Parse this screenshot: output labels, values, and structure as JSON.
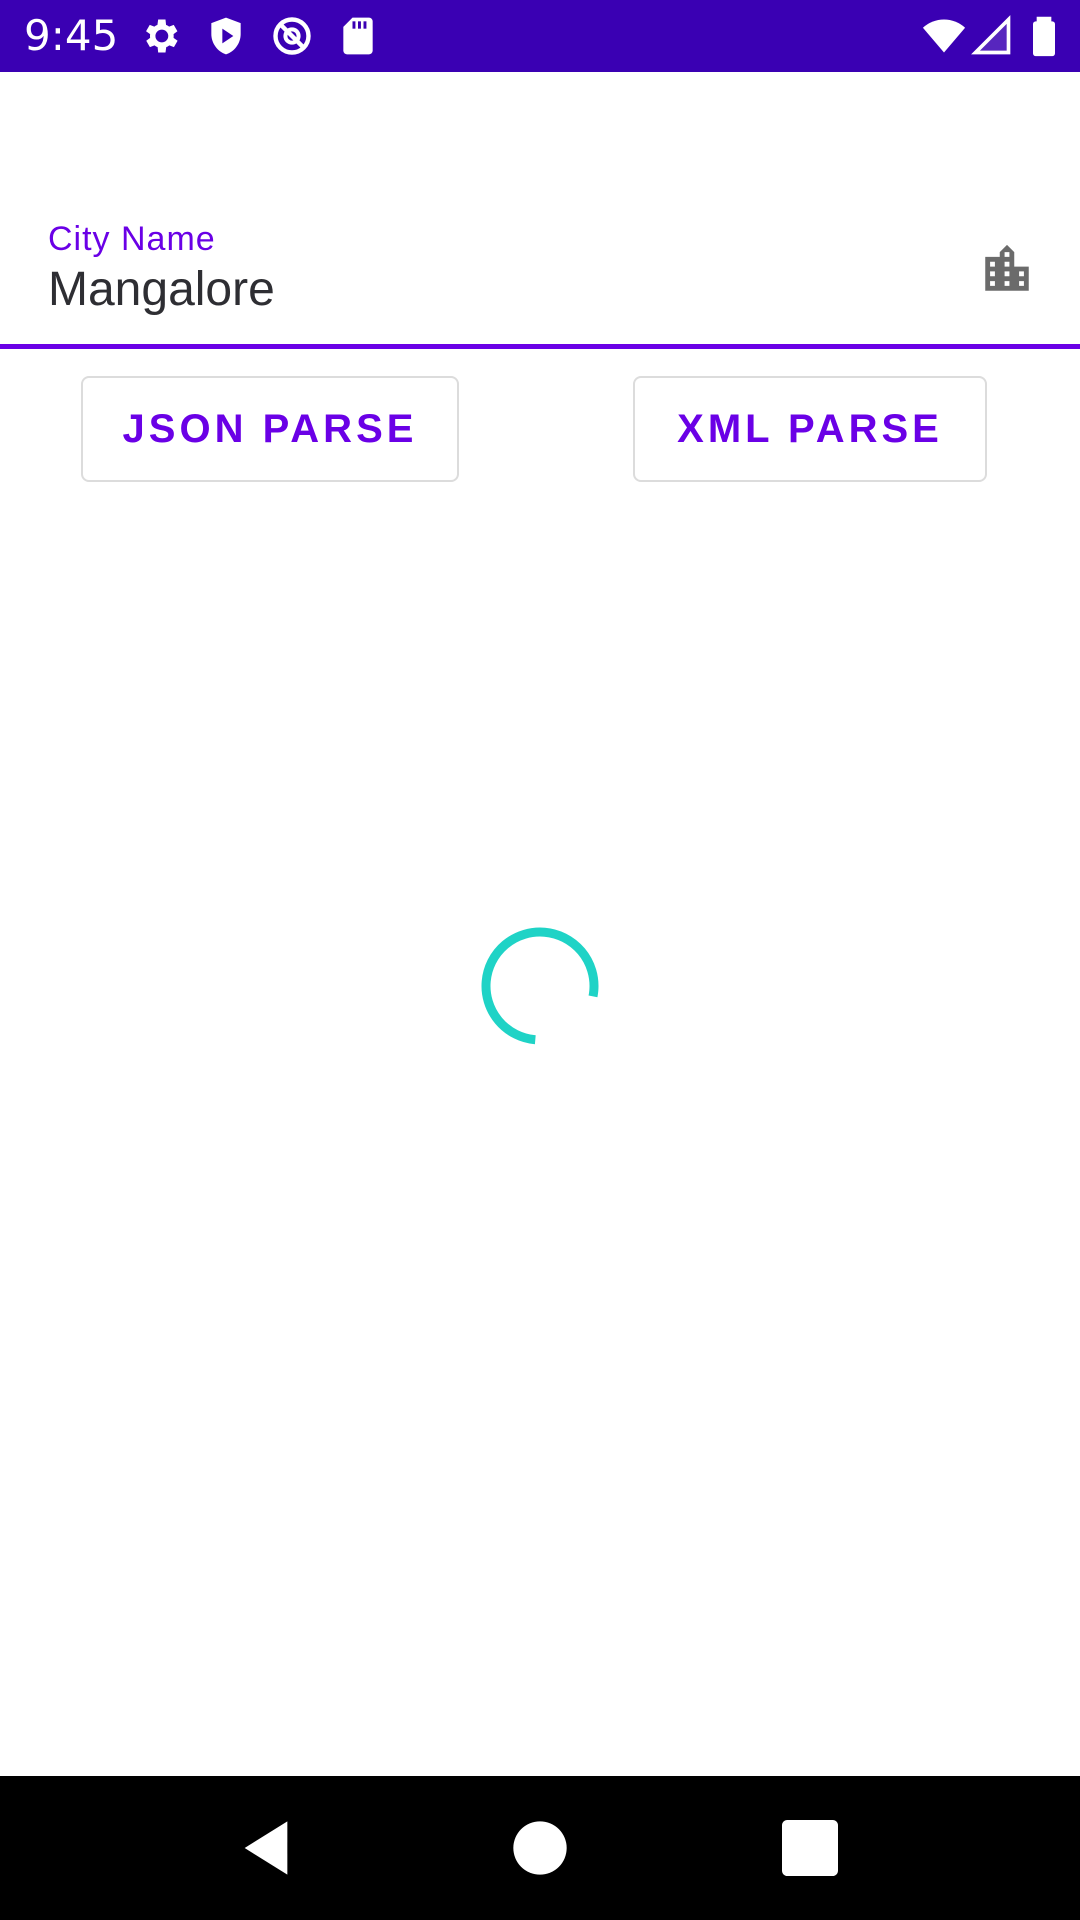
{
  "status_bar": {
    "time": "9:45",
    "left_icons": [
      "gear-icon",
      "shield-play-icon",
      "no-entry-at-icon",
      "sd-card-icon"
    ],
    "right_icons": [
      "wifi-icon",
      "cell-signal-icon",
      "battery-icon"
    ]
  },
  "city_field": {
    "label": "City Name",
    "value": "Mangalore",
    "icon": "city-icon",
    "accent_color": "#6a00e6"
  },
  "buttons": {
    "json_label": "JSON PARSE",
    "xml_label": "XML PARSE"
  },
  "loading": {
    "icon": "progress-spinner",
    "color": "#1fd3c6"
  },
  "nav_bar": {
    "items": [
      "back-icon",
      "home-icon",
      "recents-icon"
    ]
  },
  "colors": {
    "status_bar": "#3a00b3",
    "accent": "#6a00e6",
    "spinner": "#1fd3c6"
  }
}
